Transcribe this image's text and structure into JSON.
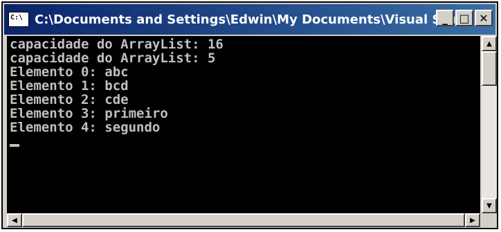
{
  "window": {
    "title": "C:\\Documents and Settings\\Edwin\\My Documents\\Visual Studi...",
    "icon": "console-icon"
  },
  "titlebar_buttons": {
    "minimize": "_",
    "maximize": "□",
    "close": "✕"
  },
  "console": {
    "lines": [
      "capacidade do ArrayList: 16",
      "capacidade do ArrayList: 5",
      "Elemento 0: abc",
      "Elemento 1: bcd",
      "Elemento 2: cde",
      "Elemento 3: primeiro",
      "Elemento 4: segundo"
    ]
  },
  "scrollbars": {
    "up": "▲",
    "down": "▼",
    "left": "◀",
    "right": "▶"
  },
  "colors": {
    "titlebar_start": "#0a246a",
    "titlebar_end": "#3a6ea5",
    "console_bg": "#000000",
    "console_fg": "#c0c0c0"
  }
}
